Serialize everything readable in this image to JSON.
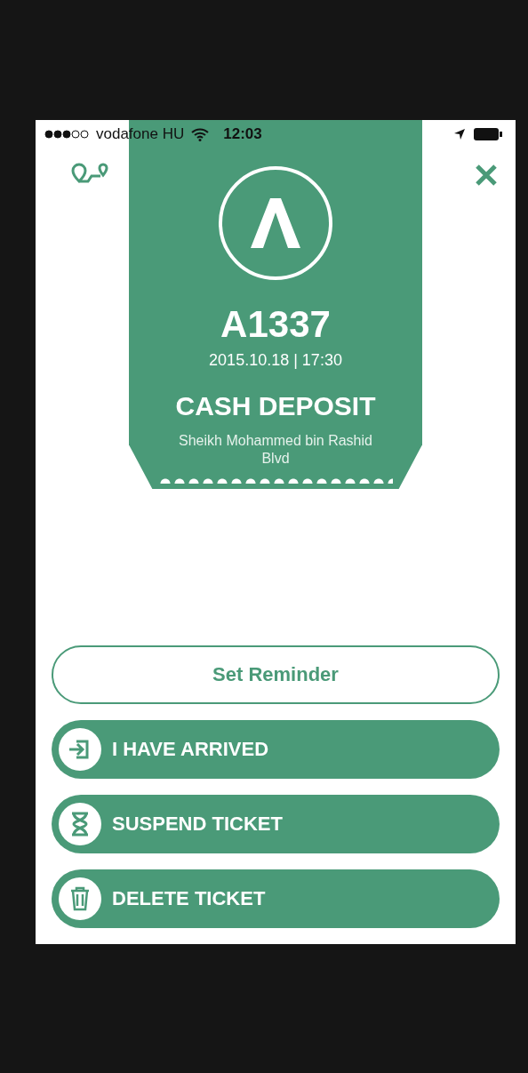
{
  "status_bar": {
    "carrier": "vodafone HU",
    "time": "12:03"
  },
  "ticket": {
    "number": "A1337",
    "datetime": "2015.10.18 | 17:30",
    "service": "CASH DEPOSIT",
    "location": "Sheikh Mohammed bin Rashid Blvd"
  },
  "buttons": [
    {
      "kind": "outline",
      "label": "Set Reminder"
    },
    {
      "kind": "arrive",
      "label": "I HAVE ARRIVED"
    },
    {
      "kind": "suspend",
      "label": "SUSPEND TICKET"
    },
    {
      "kind": "delete",
      "label": "DELETE TICKET"
    }
  ]
}
